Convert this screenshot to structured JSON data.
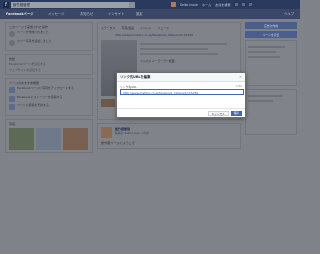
{
  "topbar": {
    "logo": "f",
    "search_text": "飯竹蔵管理",
    "user_name": "Seiko Inoue",
    "links": [
      "ホーム",
      "友達を検索"
    ]
  },
  "pagebar": {
    "tabs": [
      "Facebookページ",
      "メッセージ",
      "お知らせ",
      "インサイト",
      "設定"
    ],
    "help": "ヘルプ"
  },
  "left": {
    "box1_title": "このページで実施された操作",
    "rows1": [
      "ページが作成されました",
      "カバー写真を追加しました"
    ],
    "box2_title": "告知",
    "rows2": [
      "Facebookページを宣伝する",
      "ウェブサイトを宣伝する"
    ],
    "box3_title": "ページのおすすめ機能",
    "rows3": [
      "Facebookページに写真をアップロードする",
      "Facebookにストーリーを投稿する",
      "ページに投稿を予約する"
    ],
    "photos_title": "写真"
  },
  "center": {
    "composer_tabs": [
      "ステータス",
      "写真/動画",
      "イベント",
      "ニュース"
    ],
    "link_text": "http://www.tcetdoc.co.jp/facebook_infopoint=15250",
    "caption": "ミシカドメーラーラー紙面",
    "buttons": [
      "投稿",
      "キャンセル"
    ],
    "post2_name": "飯竹蔵管理",
    "post2_meta": "投稿者: Seiko Inoue · 2分前",
    "post2_text": "飯竹蔵ページにようこそ"
  },
  "right": {
    "buttons": [
      "広告を作成",
      "ページを宣伝"
    ]
  },
  "modal": {
    "title": "リンク先URLを編集",
    "close": "×",
    "field_label": "リンク先URL",
    "field_count": "0/50",
    "field_value": "http://www.tcetdoc.co.jp/facebook_infopoint=15250",
    "cancel": "キャンセル",
    "save": "保存"
  }
}
